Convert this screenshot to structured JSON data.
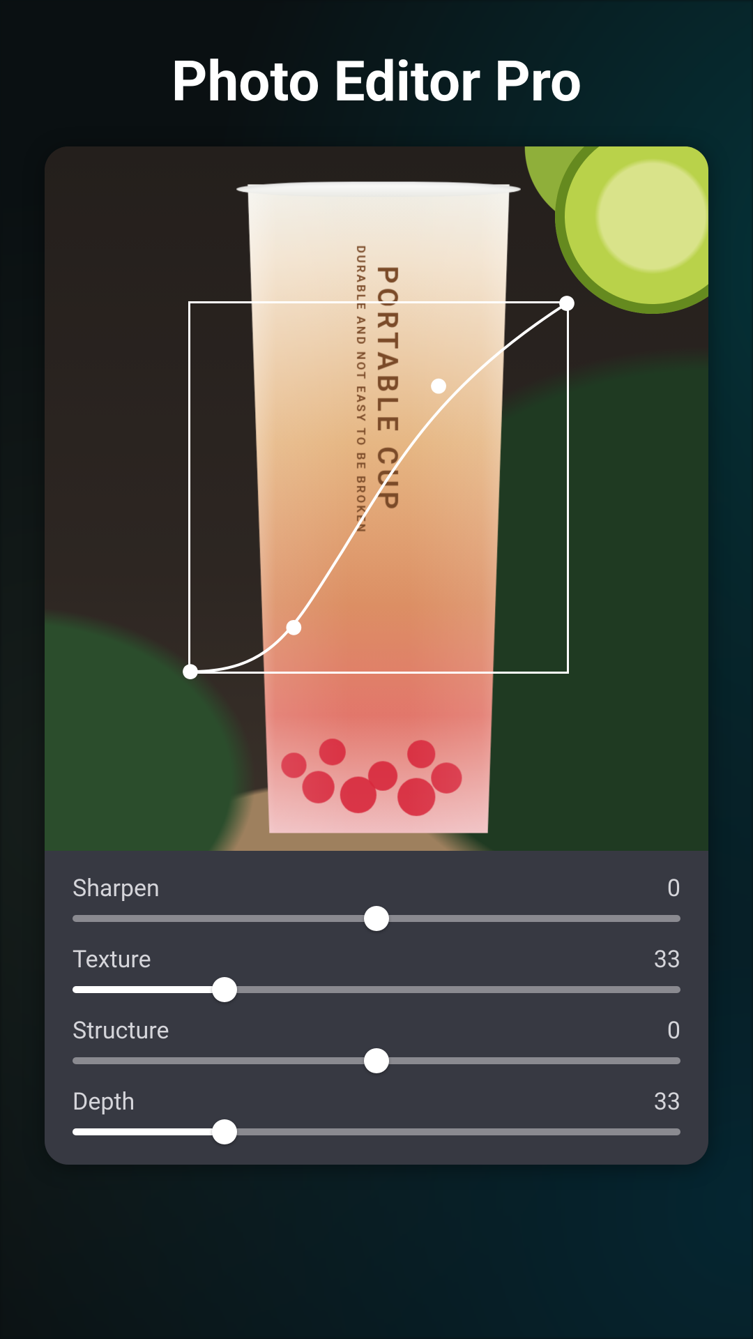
{
  "app": {
    "title": "Photo Editor Pro"
  },
  "photo": {
    "cup_label_main": "PORTABLE CUP",
    "cup_label_sub": "DURABLE AND NOT EASY TO BE BROKEN"
  },
  "sliders": [
    {
      "label": "Sharpen",
      "value": "0",
      "bipolar": true,
      "percent": 50
    },
    {
      "label": "Texture",
      "value": "33",
      "bipolar": false,
      "percent": 25
    },
    {
      "label": "Structure",
      "value": "0",
      "bipolar": true,
      "percent": 50
    },
    {
      "label": "Depth",
      "value": "33",
      "bipolar": false,
      "percent": 25
    }
  ]
}
